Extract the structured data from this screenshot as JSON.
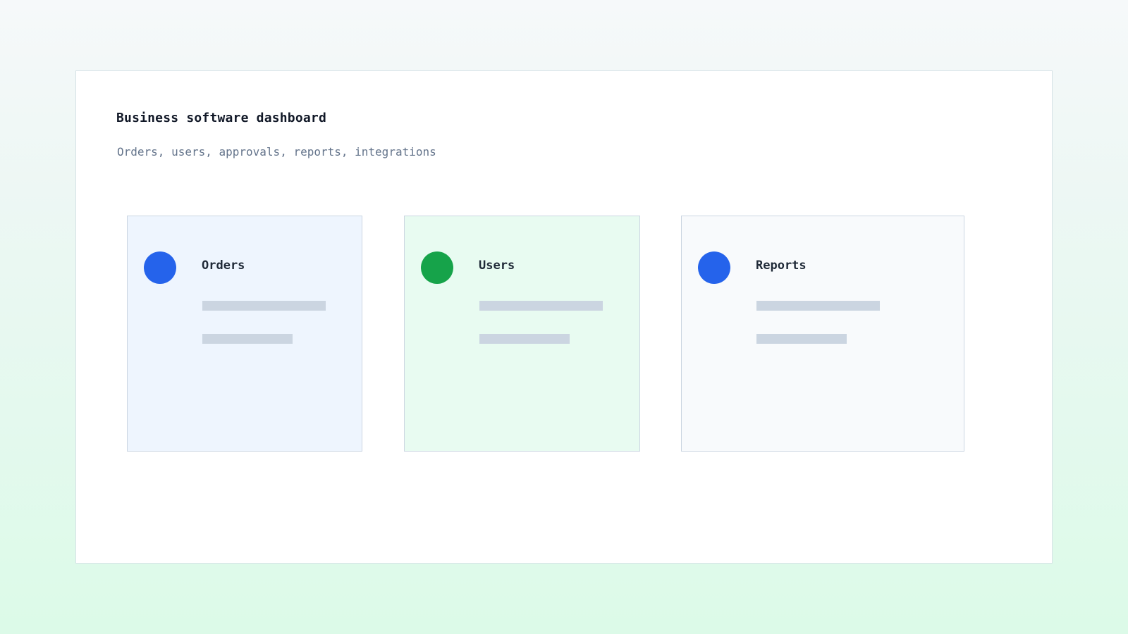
{
  "header": {
    "title": "Business software dashboard",
    "subtitle": "Orders, users, approvals, reports, integrations"
  },
  "cards": [
    {
      "label": "Orders",
      "icon": "status-dot",
      "dot_color": "#2563eb",
      "bg_color": "#eef5fe"
    },
    {
      "label": "Users",
      "icon": "status-dot",
      "dot_color": "#16a34a",
      "bg_color": "#e8fbf1"
    },
    {
      "label": "Reports",
      "icon": "status-dot",
      "dot_color": "#2563eb",
      "bg_color": "#f8fafc"
    }
  ]
}
